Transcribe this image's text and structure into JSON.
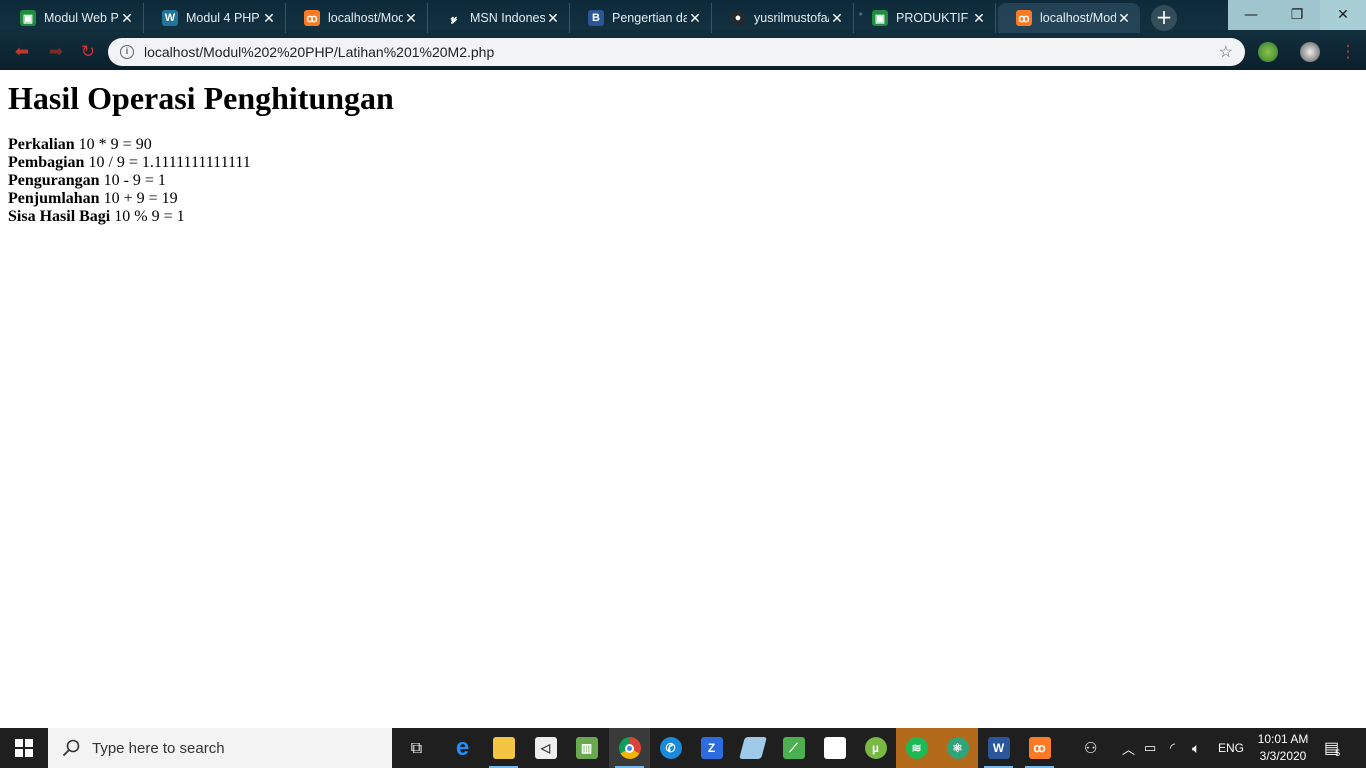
{
  "browser": {
    "tabs": [
      {
        "title": "Modul Web PHP",
        "favicon": "classroom-icon",
        "color": "#1e8e3e"
      },
      {
        "title": "Modul 4 PHP",
        "favicon": "wordpress-icon",
        "color": "#21759b"
      },
      {
        "title": "localhost/Mod",
        "favicon": "xampp-icon",
        "color": "#fb7a24"
      },
      {
        "title": "MSN Indonesi",
        "favicon": "msn-icon",
        "color": "#333333"
      },
      {
        "title": "Pengertian dan",
        "favicon": "blog-icon",
        "color": "#2b5797"
      },
      {
        "title": "yusrilmustofa/",
        "favicon": "github-icon",
        "color": "#24292e"
      },
      {
        "title": "PRODUKTIF X",
        "favicon": "classroom-icon",
        "color": "#1e8e3e"
      },
      {
        "title": "localhost/Mod",
        "favicon": "xampp-icon",
        "color": "#fb7a24",
        "active": true
      }
    ],
    "url": "localhost/Modul%202%20PHP/Latihan%201%20M2.php"
  },
  "page": {
    "heading": "Hasil Operasi Penghitungan",
    "results": [
      {
        "label": "Perkalian",
        "expression": "10 * 9 = 90"
      },
      {
        "label": "Pembagian",
        "expression": "10 / 9 = 1.1111111111111"
      },
      {
        "label": "Pengurangan",
        "expression": "10 - 9 = 1"
      },
      {
        "label": "Penjumlahan",
        "expression": "10 + 9 = 19"
      },
      {
        "label": "Sisa Hasil Bagi",
        "expression": "10 % 9 = 1"
      }
    ]
  },
  "taskbar": {
    "search_placeholder": "Type here to search",
    "tray_language": "ENG",
    "time": "10:01 AM",
    "date": "3/3/2020",
    "notification_count": "5"
  }
}
